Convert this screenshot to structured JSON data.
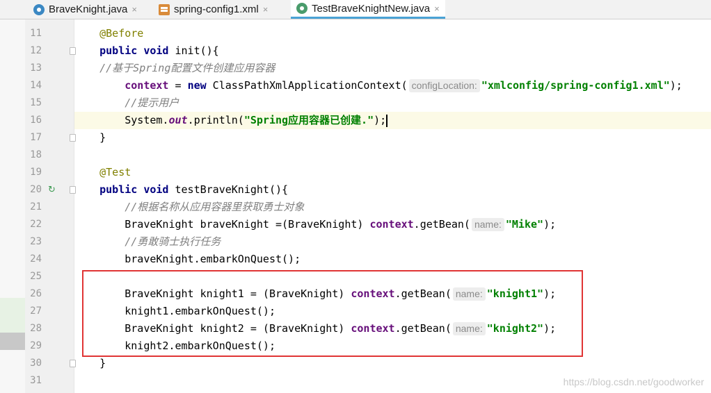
{
  "tabs": [
    {
      "label": "BraveKnight.java",
      "icon": "java-class-icon",
      "active": false
    },
    {
      "label": "spring-config1.xml",
      "icon": "xml-file-icon",
      "active": false
    },
    {
      "label": "TestBraveKnightNew.java",
      "icon": "test-class-icon",
      "active": true
    }
  ],
  "tab_close_glyph": "×",
  "editor": {
    "current_line": 16,
    "lines": [
      {
        "n": "11",
        "tokens": [
          [
            "    ",
            ""
          ],
          [
            "@Before",
            "ann"
          ]
        ]
      },
      {
        "n": "12",
        "fold": true,
        "tokens": [
          [
            "    ",
            ""
          ],
          [
            "public void",
            "kw"
          ],
          [
            " init(){",
            ""
          ]
        ]
      },
      {
        "n": "13",
        "tokens": [
          [
            "    ",
            ""
          ],
          [
            "//基于Spring配置文件创建应用容器",
            "cmt"
          ]
        ]
      },
      {
        "n": "14",
        "tokens": [
          [
            "        ",
            ""
          ],
          [
            "context",
            "fld"
          ],
          [
            " = ",
            ""
          ],
          [
            "new",
            "kw"
          ],
          [
            " ClassPathXmlApplicationContext(",
            ""
          ],
          [
            "configLocation:",
            "hint"
          ],
          [
            "\"xmlconfig/spring-config1.xml\"",
            "str"
          ],
          [
            ");",
            ""
          ]
        ]
      },
      {
        "n": "15",
        "tokens": [
          [
            "        ",
            ""
          ],
          [
            "//提示用户",
            "cmt"
          ]
        ]
      },
      {
        "n": "16",
        "tokens": [
          [
            "        System.",
            ""
          ],
          [
            "out",
            "sfld"
          ],
          [
            ".println(",
            ""
          ],
          [
            "\"Spring应用容器已创建.\"",
            "str"
          ],
          [
            ");",
            ""
          ],
          [
            "",
            "caret"
          ]
        ]
      },
      {
        "n": "17",
        "fold": true,
        "tokens": [
          [
            "    }",
            ""
          ]
        ]
      },
      {
        "n": "18",
        "tokens": []
      },
      {
        "n": "19",
        "tokens": [
          [
            "    ",
            ""
          ],
          [
            "@Test",
            "ann"
          ]
        ]
      },
      {
        "n": "20",
        "fold": true,
        "run": true,
        "tokens": [
          [
            "    ",
            ""
          ],
          [
            "public void",
            "kw"
          ],
          [
            " testBraveKnight(){",
            ""
          ]
        ]
      },
      {
        "n": "21",
        "tokens": [
          [
            "        ",
            ""
          ],
          [
            "//根据名称从应用容器里获取勇士对象",
            "cmt"
          ]
        ]
      },
      {
        "n": "22",
        "tokens": [
          [
            "        BraveKnight braveKnight =(BraveKnight) ",
            ""
          ],
          [
            "context",
            "fld"
          ],
          [
            ".getBean(",
            ""
          ],
          [
            "name:",
            "hint"
          ],
          [
            "\"Mike\"",
            "str"
          ],
          [
            ");",
            ""
          ]
        ]
      },
      {
        "n": "23",
        "tokens": [
          [
            "        ",
            ""
          ],
          [
            "//勇敢骑士执行任务",
            "cmt"
          ]
        ]
      },
      {
        "n": "24",
        "tokens": [
          [
            "        braveKnight.embarkOnQuest();",
            ""
          ]
        ]
      },
      {
        "n": "25",
        "tokens": []
      },
      {
        "n": "26",
        "tokens": [
          [
            "        BraveKnight knight1 = (BraveKnight) ",
            ""
          ],
          [
            "context",
            "fld"
          ],
          [
            ".getBean(",
            ""
          ],
          [
            "name:",
            "hint"
          ],
          [
            "\"knight1\"",
            "str"
          ],
          [
            ");",
            ""
          ]
        ]
      },
      {
        "n": "27",
        "tokens": [
          [
            "        knight1.embarkOnQuest();",
            ""
          ]
        ]
      },
      {
        "n": "28",
        "tokens": [
          [
            "        BraveKnight knight2 = (BraveKnight) ",
            ""
          ],
          [
            "context",
            "fld"
          ],
          [
            ".getBean(",
            ""
          ],
          [
            "name:",
            "hint"
          ],
          [
            "\"knight2\"",
            "str"
          ],
          [
            ");",
            ""
          ]
        ]
      },
      {
        "n": "29",
        "tokens": [
          [
            "        knight2.embarkOnQuest();",
            ""
          ]
        ]
      },
      {
        "n": "30",
        "fold": true,
        "tokens": [
          [
            "    }",
            ""
          ]
        ]
      },
      {
        "n": "31",
        "tokens": []
      }
    ]
  },
  "colors": {
    "keyword": "#000080",
    "annotation": "#808000",
    "comment": "#808080",
    "field": "#660e7a",
    "string": "#008000",
    "highlight_box": "#e03434",
    "current_line": "#fcfae6"
  },
  "watermark": "https://blog.csdn.net/goodworker"
}
